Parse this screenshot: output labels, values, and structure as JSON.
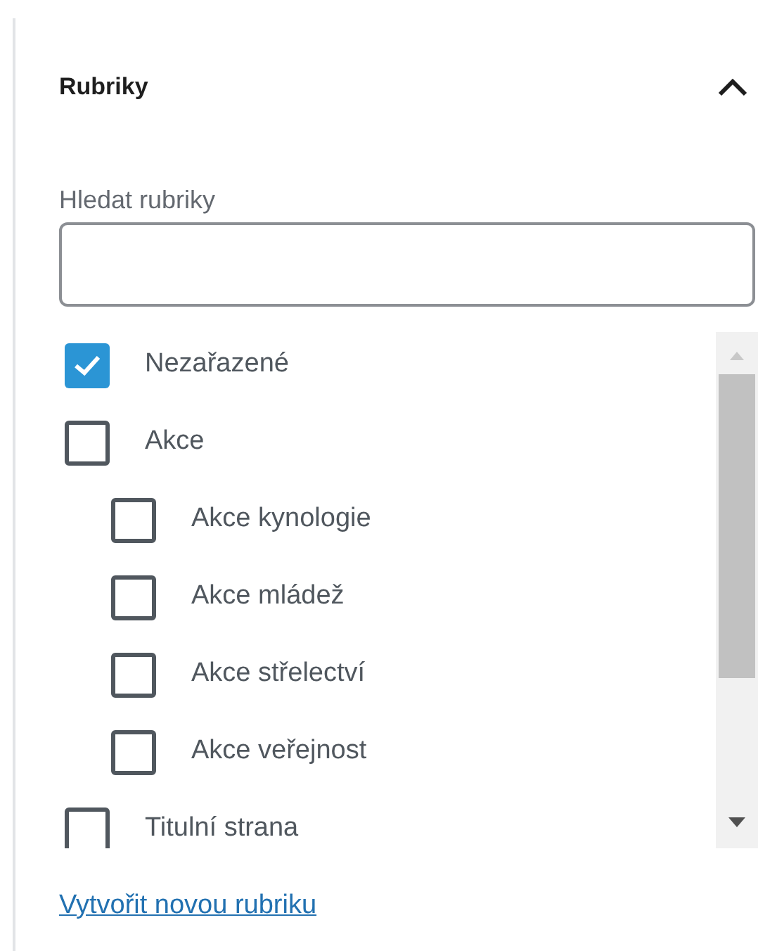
{
  "panel": {
    "title": "Rubriky",
    "expanded": true
  },
  "search": {
    "label": "Hledat rubriky"
  },
  "categories": [
    {
      "label": "Nezařazené",
      "checked": true
    },
    {
      "label": "Akce",
      "checked": false,
      "children": [
        {
          "label": "Akce kynologie",
          "checked": false
        },
        {
          "label": "Akce mládež",
          "checked": false
        },
        {
          "label": "Akce střelectví",
          "checked": false
        },
        {
          "label": "Akce veřejnost",
          "checked": false
        }
      ]
    },
    {
      "label": "Titulní strana",
      "checked": false
    }
  ],
  "add_link": "Vytvořit novou rubriku"
}
